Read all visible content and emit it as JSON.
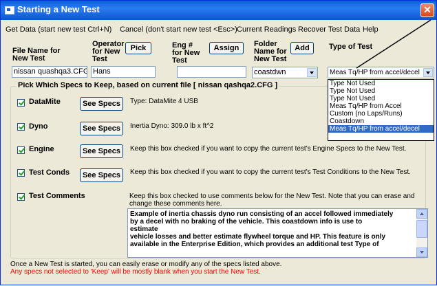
{
  "window": {
    "title": "Starting a New Test",
    "close_symbol": "✕"
  },
  "menu": [
    "Get Data (start new test  Ctrl+N)",
    "Cancel (don't start new test <Esc>)",
    "Current Readings",
    "Recover Test Data",
    "Help"
  ],
  "fields": {
    "file_name": {
      "label_line1": "File Name for",
      "label_line2": "New Test",
      "value": "nissan quashqa3.CFG"
    },
    "operator": {
      "label_line1": "Operator",
      "label_line2": "for New",
      "label_line3": "Test",
      "button": "Pick",
      "value": "Hans"
    },
    "eng": {
      "label_line1": "Eng #",
      "label_line2": "for New",
      "label_line3": "Test",
      "button": "Assign",
      "value": ""
    },
    "folder": {
      "label_line1": "Folder",
      "label_line2": "Name for",
      "label_line3": "New Test",
      "button": "Add",
      "value": "coastdwn"
    },
    "type": {
      "label": "Type of Test",
      "value": "Meas Tq/HP from accel/decel"
    }
  },
  "type_options": [
    "Type Not Used",
    "Type Not Used",
    "Type Not Used",
    "Meas Tq/HP from Accel",
    "Custom (no Laps/Runs)",
    "Coastdown",
    "Meas Tq/HP from accel/decel"
  ],
  "group_title": "Pick Which Specs to Keep, based on current file [ nissan qashqa2.CFG ]",
  "specs": [
    {
      "label": "DataMite",
      "button": "See Specs",
      "desc": "Type: DataMite 4 USB"
    },
    {
      "label": "Dyno",
      "button": "See Specs",
      "desc": "Inertia Dyno:  309.0 lb x ft^2"
    },
    {
      "label": "Engine",
      "button": "See Specs",
      "desc": "Keep this box checked if you want to copy the current test's Engine Specs to the New Test."
    },
    {
      "label": "Test Conds",
      "button": "See Specs",
      "desc": "Keep this box checked if you want to copy the current test's Test Conditions to the New Test."
    }
  ],
  "comments": {
    "label": "Test Comments",
    "desc_line1": "Keep this box checked to use comments below for the New Test.  Note that you can erase and",
    "desc_line2": "change these comments here.",
    "text_lines": [
      "Example of inertia chassis dyno run consisting of an accel followed immediately",
      "by a decel with no braking of the vehicle.  This coastdown info is use to",
      "estimate",
      "vehicle losses and better estimate flywheel torque and HP.  This feature is only",
      "available in the Enterprise Edition, which provides an additional test Type of"
    ]
  },
  "footer": {
    "line1": "Once a New Test is started, you can easily erase or modify any of the specs listed above.",
    "line2": "Any specs not selected to 'Keep' will be mostly blank when you start the New Test."
  }
}
